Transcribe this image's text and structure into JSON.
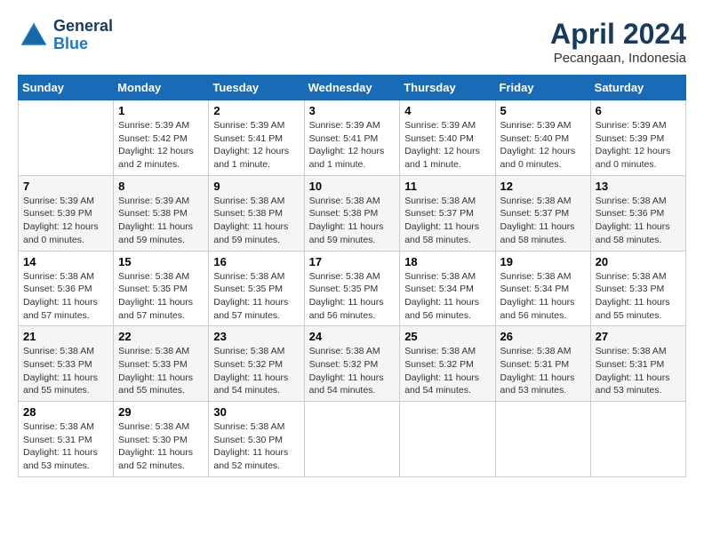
{
  "header": {
    "logo_line1": "General",
    "logo_line2": "Blue",
    "month_year": "April 2024",
    "location": "Pecangaan, Indonesia"
  },
  "weekdays": [
    "Sunday",
    "Monday",
    "Tuesday",
    "Wednesday",
    "Thursday",
    "Friday",
    "Saturday"
  ],
  "weeks": [
    [
      {
        "day": "",
        "info": ""
      },
      {
        "day": "1",
        "info": "Sunrise: 5:39 AM\nSunset: 5:42 PM\nDaylight: 12 hours\nand 2 minutes."
      },
      {
        "day": "2",
        "info": "Sunrise: 5:39 AM\nSunset: 5:41 PM\nDaylight: 12 hours\nand 1 minute."
      },
      {
        "day": "3",
        "info": "Sunrise: 5:39 AM\nSunset: 5:41 PM\nDaylight: 12 hours\nand 1 minute."
      },
      {
        "day": "4",
        "info": "Sunrise: 5:39 AM\nSunset: 5:40 PM\nDaylight: 12 hours\nand 1 minute."
      },
      {
        "day": "5",
        "info": "Sunrise: 5:39 AM\nSunset: 5:40 PM\nDaylight: 12 hours\nand 0 minutes."
      },
      {
        "day": "6",
        "info": "Sunrise: 5:39 AM\nSunset: 5:39 PM\nDaylight: 12 hours\nand 0 minutes."
      }
    ],
    [
      {
        "day": "7",
        "info": "Sunrise: 5:39 AM\nSunset: 5:39 PM\nDaylight: 12 hours\nand 0 minutes."
      },
      {
        "day": "8",
        "info": "Sunrise: 5:39 AM\nSunset: 5:38 PM\nDaylight: 11 hours\nand 59 minutes."
      },
      {
        "day": "9",
        "info": "Sunrise: 5:38 AM\nSunset: 5:38 PM\nDaylight: 11 hours\nand 59 minutes."
      },
      {
        "day": "10",
        "info": "Sunrise: 5:38 AM\nSunset: 5:38 PM\nDaylight: 11 hours\nand 59 minutes."
      },
      {
        "day": "11",
        "info": "Sunrise: 5:38 AM\nSunset: 5:37 PM\nDaylight: 11 hours\nand 58 minutes."
      },
      {
        "day": "12",
        "info": "Sunrise: 5:38 AM\nSunset: 5:37 PM\nDaylight: 11 hours\nand 58 minutes."
      },
      {
        "day": "13",
        "info": "Sunrise: 5:38 AM\nSunset: 5:36 PM\nDaylight: 11 hours\nand 58 minutes."
      }
    ],
    [
      {
        "day": "14",
        "info": "Sunrise: 5:38 AM\nSunset: 5:36 PM\nDaylight: 11 hours\nand 57 minutes."
      },
      {
        "day": "15",
        "info": "Sunrise: 5:38 AM\nSunset: 5:35 PM\nDaylight: 11 hours\nand 57 minutes."
      },
      {
        "day": "16",
        "info": "Sunrise: 5:38 AM\nSunset: 5:35 PM\nDaylight: 11 hours\nand 57 minutes."
      },
      {
        "day": "17",
        "info": "Sunrise: 5:38 AM\nSunset: 5:35 PM\nDaylight: 11 hours\nand 56 minutes."
      },
      {
        "day": "18",
        "info": "Sunrise: 5:38 AM\nSunset: 5:34 PM\nDaylight: 11 hours\nand 56 minutes."
      },
      {
        "day": "19",
        "info": "Sunrise: 5:38 AM\nSunset: 5:34 PM\nDaylight: 11 hours\nand 56 minutes."
      },
      {
        "day": "20",
        "info": "Sunrise: 5:38 AM\nSunset: 5:33 PM\nDaylight: 11 hours\nand 55 minutes."
      }
    ],
    [
      {
        "day": "21",
        "info": "Sunrise: 5:38 AM\nSunset: 5:33 PM\nDaylight: 11 hours\nand 55 minutes."
      },
      {
        "day": "22",
        "info": "Sunrise: 5:38 AM\nSunset: 5:33 PM\nDaylight: 11 hours\nand 55 minutes."
      },
      {
        "day": "23",
        "info": "Sunrise: 5:38 AM\nSunset: 5:32 PM\nDaylight: 11 hours\nand 54 minutes."
      },
      {
        "day": "24",
        "info": "Sunrise: 5:38 AM\nSunset: 5:32 PM\nDaylight: 11 hours\nand 54 minutes."
      },
      {
        "day": "25",
        "info": "Sunrise: 5:38 AM\nSunset: 5:32 PM\nDaylight: 11 hours\nand 54 minutes."
      },
      {
        "day": "26",
        "info": "Sunrise: 5:38 AM\nSunset: 5:31 PM\nDaylight: 11 hours\nand 53 minutes."
      },
      {
        "day": "27",
        "info": "Sunrise: 5:38 AM\nSunset: 5:31 PM\nDaylight: 11 hours\nand 53 minutes."
      }
    ],
    [
      {
        "day": "28",
        "info": "Sunrise: 5:38 AM\nSunset: 5:31 PM\nDaylight: 11 hours\nand 53 minutes."
      },
      {
        "day": "29",
        "info": "Sunrise: 5:38 AM\nSunset: 5:30 PM\nDaylight: 11 hours\nand 52 minutes."
      },
      {
        "day": "30",
        "info": "Sunrise: 5:38 AM\nSunset: 5:30 PM\nDaylight: 11 hours\nand 52 minutes."
      },
      {
        "day": "",
        "info": ""
      },
      {
        "day": "",
        "info": ""
      },
      {
        "day": "",
        "info": ""
      },
      {
        "day": "",
        "info": ""
      }
    ]
  ]
}
